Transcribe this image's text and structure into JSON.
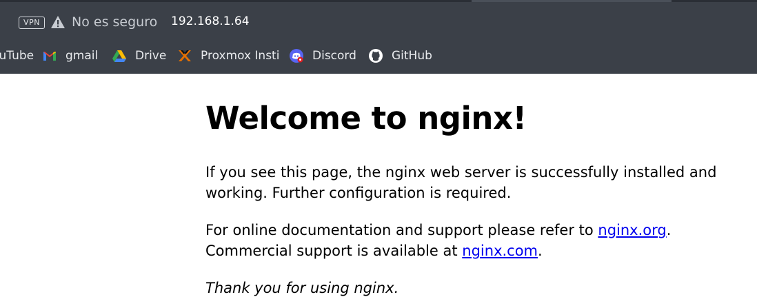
{
  "browser": {
    "vpn_label": "VPN",
    "security_text": "No es seguro",
    "url": "192.168.1.64",
    "bookmarks": [
      {
        "label": "YouTube",
        "icon": "youtube-icon"
      },
      {
        "label": "gmail",
        "icon": "gmail-icon"
      },
      {
        "label": "Drive",
        "icon": "drive-icon"
      },
      {
        "label": "Proxmox Insti",
        "icon": "proxmox-icon"
      },
      {
        "label": "Discord",
        "icon": "discord-icon"
      },
      {
        "label": "GitHub",
        "icon": "github-icon"
      }
    ],
    "chrome_color": "#3b4048"
  },
  "page": {
    "title": "Welcome to nginx!",
    "p1": "If you see this page, the nginx web server is successfully installed and working. Further configuration is required.",
    "p2_before": "For online documentation and support please refer to ",
    "p2_link": "nginx.org",
    "p2_mid": ".",
    "p2_line2_before": "Commercial support is available at ",
    "p2_link2": "nginx.com",
    "p2_after": ".",
    "p3": "Thank you for using nginx.",
    "link_color": "#0000ee"
  }
}
